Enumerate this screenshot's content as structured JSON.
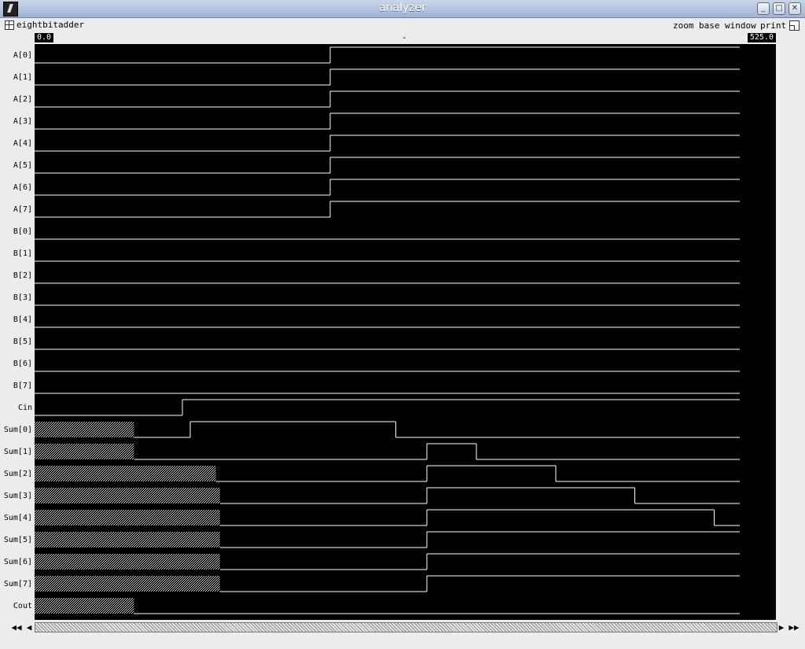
{
  "window": {
    "title": "analyzer",
    "icon": "terminal-app-icon",
    "controls": [
      "_",
      "□",
      "✕"
    ]
  },
  "menubar": {
    "design": "eightbitadder",
    "items": [
      "zoom",
      "base",
      "window",
      "print"
    ]
  },
  "ruler": {
    "start": "0.0",
    "mid": "-",
    "end": "525.0"
  },
  "timing": {
    "t_start": 0,
    "t_end": 525
  },
  "signals": [
    {
      "name": "A[0]",
      "kind": "bit",
      "events": [
        [
          0,
          0
        ],
        [
          220,
          1
        ]
      ]
    },
    {
      "name": "A[1]",
      "kind": "bit",
      "events": [
        [
          0,
          0
        ],
        [
          220,
          1
        ]
      ]
    },
    {
      "name": "A[2]",
      "kind": "bit",
      "events": [
        [
          0,
          0
        ],
        [
          220,
          1
        ]
      ]
    },
    {
      "name": "A[3]",
      "kind": "bit",
      "events": [
        [
          0,
          0
        ],
        [
          220,
          1
        ]
      ]
    },
    {
      "name": "A[4]",
      "kind": "bit",
      "events": [
        [
          0,
          0
        ],
        [
          220,
          1
        ]
      ]
    },
    {
      "name": "A[5]",
      "kind": "bit",
      "events": [
        [
          0,
          0
        ],
        [
          220,
          1
        ]
      ]
    },
    {
      "name": "A[6]",
      "kind": "bit",
      "events": [
        [
          0,
          0
        ],
        [
          220,
          1
        ]
      ]
    },
    {
      "name": "A[7]",
      "kind": "bit",
      "events": [
        [
          0,
          0
        ],
        [
          220,
          1
        ]
      ]
    },
    {
      "name": "B[0]",
      "kind": "bit",
      "events": [
        [
          0,
          0
        ]
      ]
    },
    {
      "name": "B[1]",
      "kind": "bit",
      "events": [
        [
          0,
          0
        ]
      ]
    },
    {
      "name": "B[2]",
      "kind": "bit",
      "events": [
        [
          0,
          0
        ]
      ]
    },
    {
      "name": "B[3]",
      "kind": "bit",
      "events": [
        [
          0,
          0
        ]
      ]
    },
    {
      "name": "B[4]",
      "kind": "bit",
      "events": [
        [
          0,
          0
        ]
      ]
    },
    {
      "name": "B[5]",
      "kind": "bit",
      "events": [
        [
          0,
          0
        ]
      ]
    },
    {
      "name": "B[6]",
      "kind": "bit",
      "events": [
        [
          0,
          0
        ]
      ]
    },
    {
      "name": "B[7]",
      "kind": "bit",
      "events": [
        [
          0,
          0
        ]
      ]
    },
    {
      "name": "Cin",
      "kind": "bit",
      "events": [
        [
          0,
          0
        ],
        [
          110,
          1
        ]
      ]
    },
    {
      "name": "Sum[0]",
      "kind": "bit",
      "events": [
        [
          0,
          "X"
        ],
        [
          74,
          0
        ],
        [
          116,
          1
        ],
        [
          269,
          0
        ]
      ]
    },
    {
      "name": "Sum[1]",
      "kind": "bit",
      "events": [
        [
          0,
          "X"
        ],
        [
          74,
          0
        ],
        [
          292,
          1
        ],
        [
          329,
          0
        ]
      ]
    },
    {
      "name": "Sum[2]",
      "kind": "bit",
      "events": [
        [
          0,
          "X"
        ],
        [
          135,
          0
        ],
        [
          292,
          1
        ],
        [
          388,
          0
        ]
      ]
    },
    {
      "name": "Sum[3]",
      "kind": "bit",
      "events": [
        [
          0,
          "X"
        ],
        [
          138,
          0
        ],
        [
          292,
          1
        ],
        [
          447,
          0
        ]
      ]
    },
    {
      "name": "Sum[4]",
      "kind": "bit",
      "events": [
        [
          0,
          "X"
        ],
        [
          138,
          0
        ],
        [
          292,
          1
        ],
        [
          506,
          0
        ]
      ]
    },
    {
      "name": "Sum[5]",
      "kind": "bit",
      "events": [
        [
          0,
          "X"
        ],
        [
          138,
          0
        ],
        [
          292,
          1
        ]
      ]
    },
    {
      "name": "Sum[6]",
      "kind": "bit",
      "events": [
        [
          0,
          "X"
        ],
        [
          138,
          0
        ],
        [
          292,
          1
        ]
      ]
    },
    {
      "name": "Sum[7]",
      "kind": "bit",
      "events": [
        [
          0,
          "X"
        ],
        [
          138,
          0
        ],
        [
          292,
          1
        ]
      ]
    },
    {
      "name": "Cout",
      "kind": "bit",
      "events": [
        [
          0,
          "X"
        ],
        [
          74,
          0
        ]
      ]
    }
  ],
  "scrollbar": {
    "left_fast": "◀◀",
    "left": "◀",
    "right": "▶",
    "right_fast": "▶▶"
  },
  "colors": {
    "wave_bg": "#000000",
    "wave_line": "#ffffff",
    "unknown_hatch": "#cfcfcf"
  }
}
